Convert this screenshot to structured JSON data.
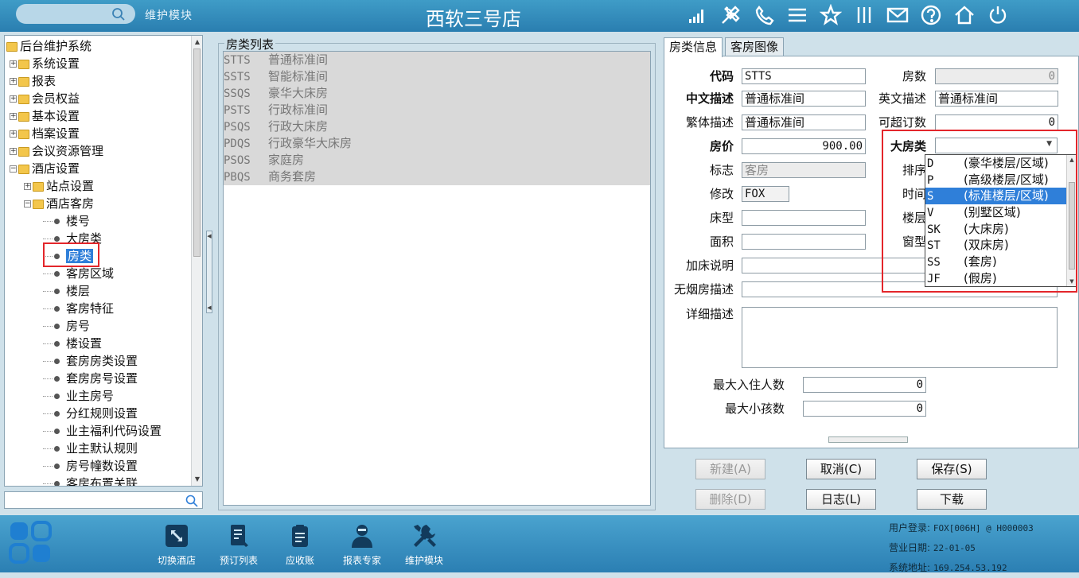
{
  "topbar": {
    "search_placeholder": "",
    "module_label": "维护模块",
    "store_title": "西软三号店",
    "icons": [
      "signal-icon",
      "tools-icon",
      "phone-icon",
      "menu-icon",
      "star-icon",
      "columns-icon",
      "mail-icon",
      "help-icon",
      "home-icon",
      "power-icon"
    ]
  },
  "tree": {
    "root": "后台维护系统",
    "level1": [
      "系统设置",
      "报表",
      "会员权益",
      "基本设置",
      "档案设置",
      "会议资源管理",
      "酒店设置"
    ],
    "level2": [
      "站点设置",
      "酒店客房"
    ],
    "leaves": [
      "楼号",
      "大房类",
      "房类",
      "客房区域",
      "楼层",
      "客房特征",
      "房号",
      "楼设置",
      "套房房类设置",
      "套房房号设置",
      "业主房号",
      "分红规则设置",
      "业主福利代码设置",
      "业主默认规则",
      "房号幢数设置",
      "客房布置关联"
    ],
    "selected": "房类",
    "search_value": ""
  },
  "room_list": {
    "caption": "房类列表",
    "rows": [
      {
        "code": "STTS",
        "name": "普通标准间"
      },
      {
        "code": "SSTS",
        "name": "智能标准间"
      },
      {
        "code": "SSQS",
        "name": "豪华大床房"
      },
      {
        "code": "PSTS",
        "name": "行政标准间"
      },
      {
        "code": "PSQS",
        "name": "行政大床房"
      },
      {
        "code": "PDQS",
        "name": "行政豪华大床房"
      },
      {
        "code": "PSOS",
        "name": "家庭房"
      },
      {
        "code": "PBQS",
        "name": "商务套房"
      }
    ]
  },
  "tabs": [
    "房类信息",
    "客房图像"
  ],
  "form": {
    "code_label": "代码",
    "code_value": "STTS",
    "rooms_label": "房数",
    "rooms_value": "0",
    "cn_label": "中文描述",
    "cn_value": "普通标准间",
    "en_label": "英文描述",
    "en_value": "普通标准间",
    "tw_label": "繁体描述",
    "tw_value": "普通标准间",
    "overbook_label": "可超订数",
    "overbook_value": "0",
    "price_label": "房价",
    "price_value": "900.00",
    "bigtype_label": "大房类",
    "bigtype_value": "",
    "flag_label": "标志",
    "flag_value": "客房",
    "sort_label": "排序",
    "modify_label": "修改",
    "modify_value": "FOX",
    "time_label": "时间",
    "bed_label": "床型",
    "bed_value": "",
    "floor_label": "楼层",
    "area_label": "面积",
    "area_value": "",
    "window_label": "窗型",
    "extrabed_label": "加床说明",
    "extrabed_value": "",
    "nosmoke_label": "无烟房描述",
    "nosmoke_value": "",
    "detail_label": "详细描述",
    "maxadult_label": "最大入住人数",
    "maxadult_value": "0",
    "maxchild_label": "最大小孩数",
    "maxchild_value": "0"
  },
  "dropdown": {
    "options": [
      {
        "code": "D",
        "name": "(豪华楼层/区域)"
      },
      {
        "code": "P",
        "name": "(高级楼层/区域)"
      },
      {
        "code": "S",
        "name": "(标准楼层/区域)"
      },
      {
        "code": "V",
        "name": "(别墅区域)"
      },
      {
        "code": "SK",
        "name": "(大床房)"
      },
      {
        "code": "ST",
        "name": "(双床房)"
      },
      {
        "code": "SS",
        "name": "(套房)"
      },
      {
        "code": "JF",
        "name": "(假房)"
      }
    ],
    "selected_index": 2
  },
  "buttons": {
    "new": "新建(A)",
    "cancel": "取消(C)",
    "save": "保存(S)",
    "delete": "删除(D)",
    "log": "日志(L)",
    "download": "下载"
  },
  "bottombar": {
    "items": [
      {
        "label": "切换酒店",
        "icon": "switch-hotel-icon"
      },
      {
        "label": "预订列表",
        "icon": "booking-list-icon"
      },
      {
        "label": "应收账",
        "icon": "receivable-icon"
      },
      {
        "label": "报表专家",
        "icon": "report-expert-icon"
      },
      {
        "label": "维护模块",
        "icon": "maintenance-icon"
      }
    ],
    "user_label": "用户登录:",
    "user_value": "FOX[006H] @ H000003",
    "date_label": "营业日期:",
    "date_value": "22-01-05",
    "ip_label": "系统地址:",
    "ip_value": "169.254.53.192"
  },
  "colors": {
    "topbar": "#2a7eb0",
    "bottombar": "#2b7fb3",
    "background": "#cfe1ea",
    "selection": "#2f7fd9",
    "highlight_box": "#e3262b"
  }
}
